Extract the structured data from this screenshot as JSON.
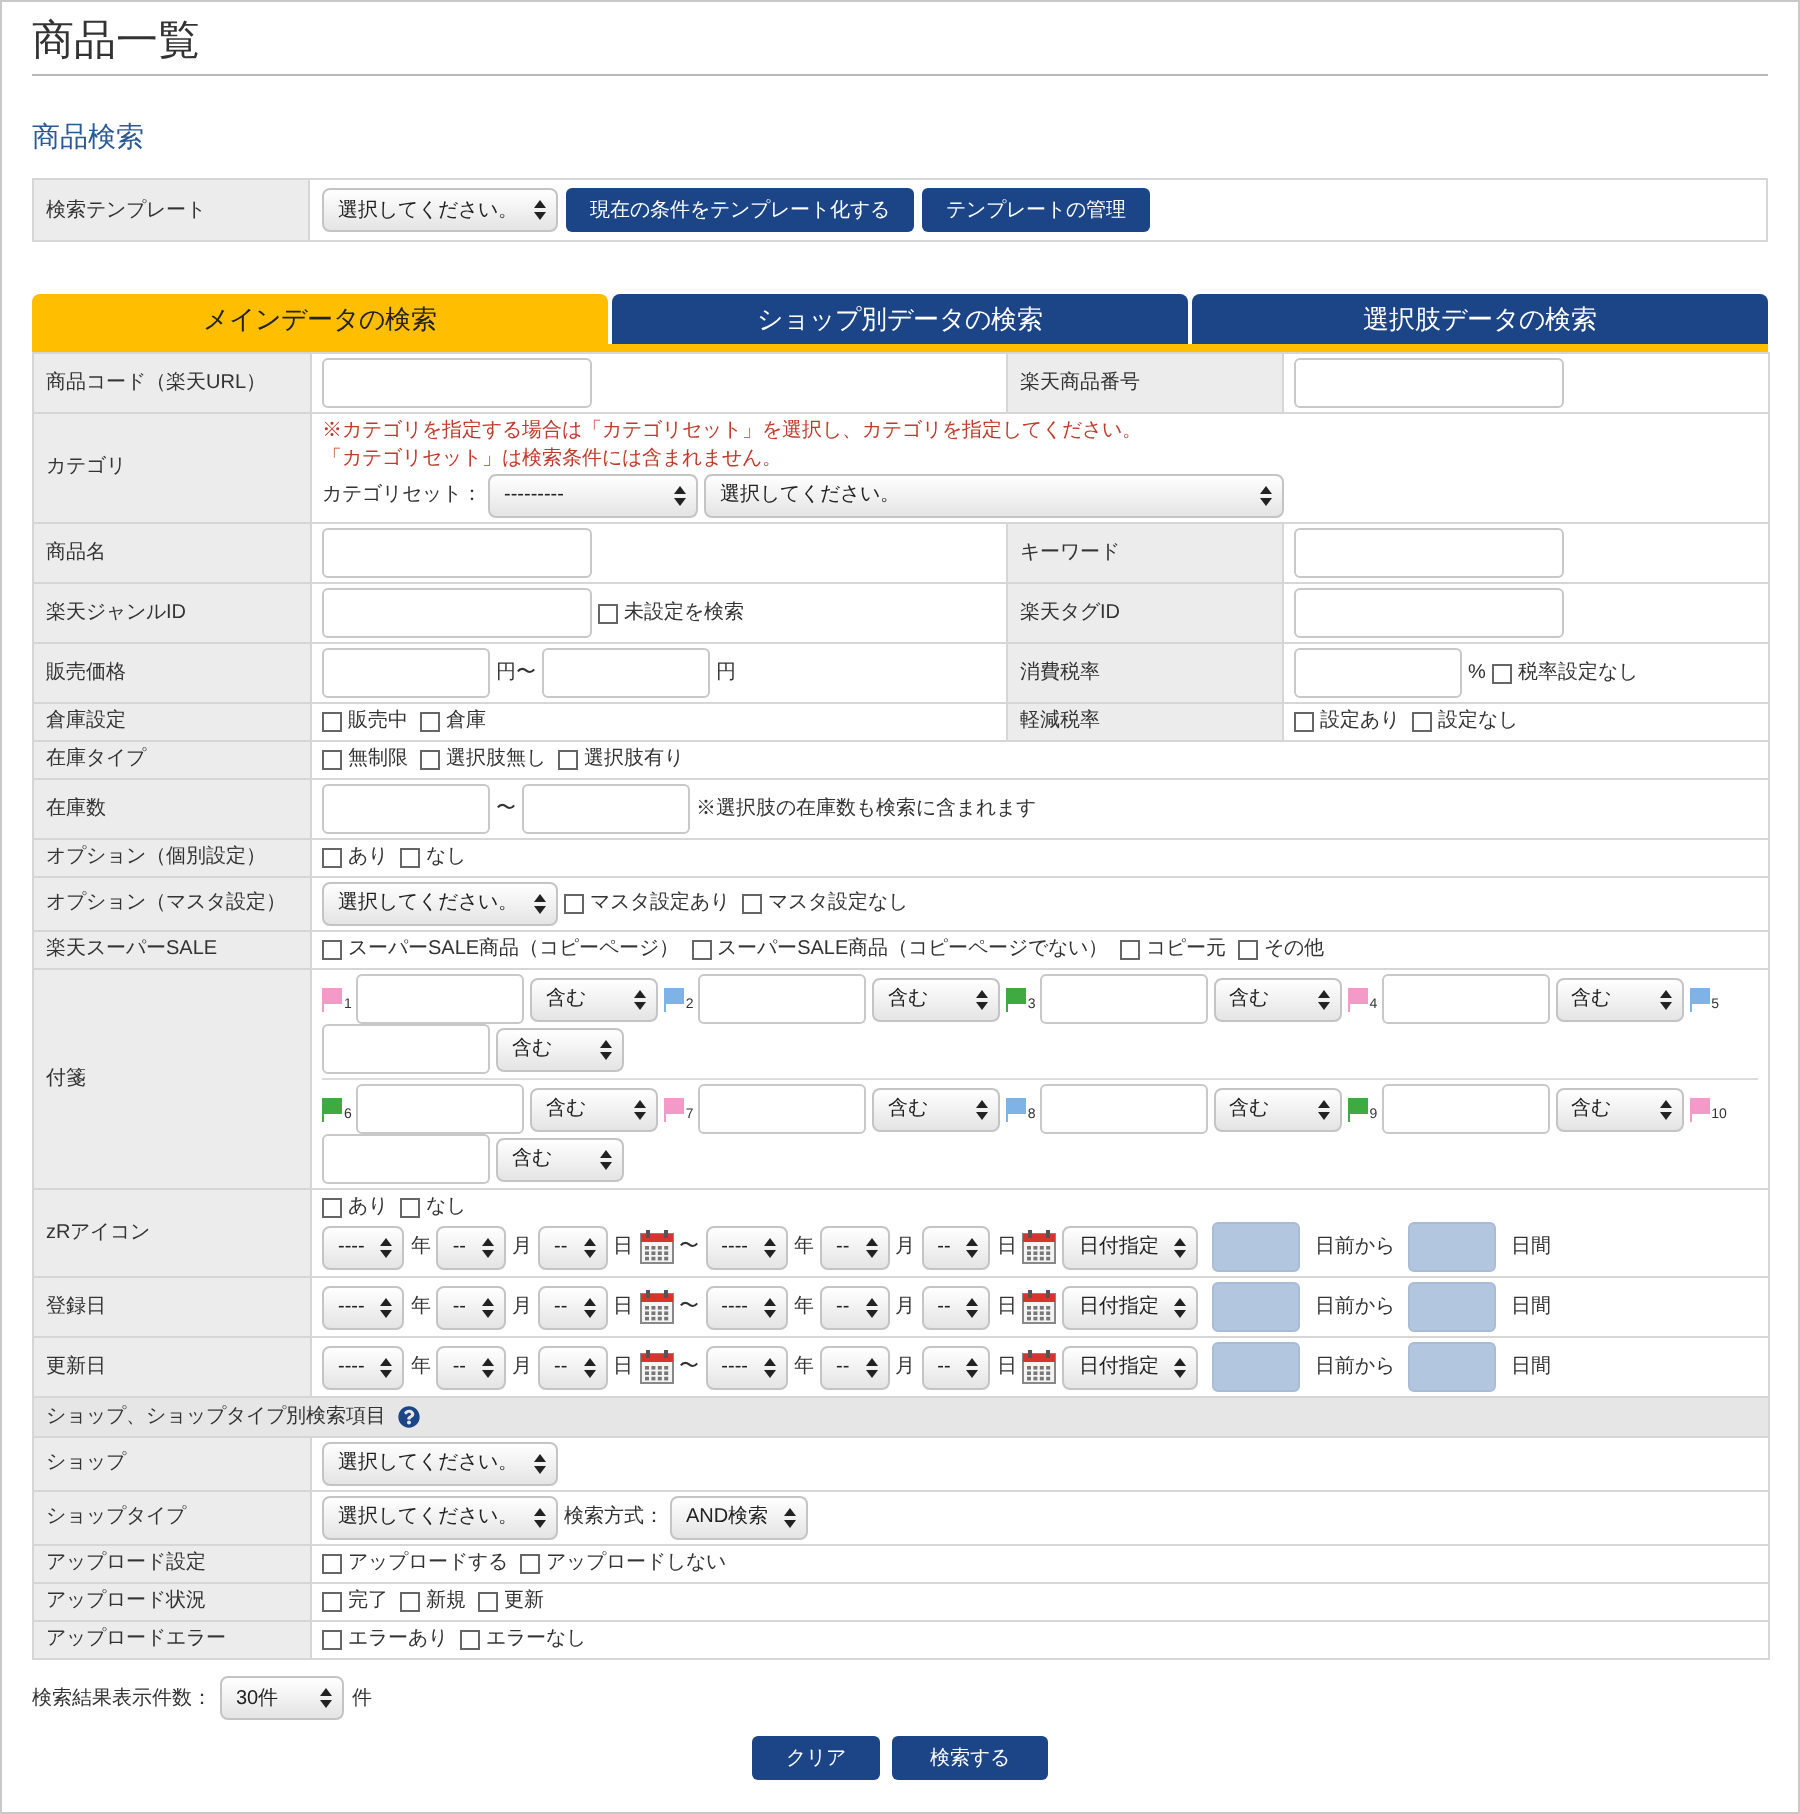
{
  "title": "商品一覧",
  "search_heading": "商品検索",
  "template": {
    "label": "検索テンプレート",
    "select": "選択してください。",
    "buttons": [
      "現在の条件をテンプレート化する",
      "テンプレートの管理"
    ]
  },
  "tabs": [
    {
      "label": "メインデータの検索",
      "selected": true
    },
    {
      "label": "ショップ別データの検索",
      "selected": false
    },
    {
      "label": "選択肢データの検索",
      "selected": false
    }
  ],
  "rows": [
    {
      "kind": "pair",
      "label": "商品コード（楽天URL）",
      "lines": [
        [
          {
            "kind": "input"
          }
        ]
      ],
      "label2": "楽天商品番号",
      "lines2": [
        [
          {
            "kind": "input"
          }
        ]
      ]
    },
    {
      "kind": "single",
      "label": "カテゴリ",
      "lines": [
        [
          {
            "kind": "note",
            "text": "※カテゴリを指定する場合は「カテゴリセット」を選択し、カテゴリを指定してください。"
          }
        ],
        [
          {
            "kind": "note",
            "text": "「カテゴリセット」は検索条件には含まれません。"
          }
        ],
        [
          {
            "kind": "text",
            "text": "カテゴリセット："
          },
          {
            "kind": "large-select",
            "value": "---------"
          },
          {
            "kind": "wide-select",
            "value": "選択してください。"
          }
        ]
      ]
    },
    {
      "kind": "pair",
      "label": "商品名",
      "lines": [
        [
          {
            "kind": "input"
          }
        ]
      ],
      "label2": "キーワード",
      "lines2": [
        [
          {
            "kind": "input"
          }
        ]
      ]
    },
    {
      "kind": "pair",
      "label": "楽天ジャンルID",
      "lines": [
        [
          {
            "kind": "input"
          },
          {
            "kind": "checkbox",
            "label": "未設定を検索",
            "checked": false
          }
        ]
      ],
      "label2": "楽天タグID",
      "lines2": [
        [
          {
            "kind": "input"
          }
        ]
      ]
    },
    {
      "kind": "pair",
      "label": "販売価格",
      "lines": [
        [
          {
            "kind": "short-input"
          },
          {
            "kind": "text",
            "text": "円〜"
          },
          {
            "kind": "short-input"
          },
          {
            "kind": "text",
            "text": "円"
          }
        ]
      ],
      "label2": "消費税率",
      "lines2": [
        [
          {
            "kind": "short-input"
          },
          {
            "kind": "text",
            "text": "%"
          },
          {
            "kind": "checkbox",
            "label": "税率設定なし",
            "checked": false
          }
        ]
      ]
    },
    {
      "kind": "pair",
      "label": "倉庫設定",
      "lines": [
        [
          {
            "kind": "checkbox",
            "label": "販売中",
            "checked": false
          },
          {
            "kind": "checkbox",
            "label": "倉庫",
            "checked": false
          }
        ]
      ],
      "label2": "軽減税率",
      "lines2": [
        [
          {
            "kind": "checkbox",
            "label": "設定あり",
            "checked": false
          },
          {
            "kind": "checkbox",
            "label": "設定なし",
            "checked": false
          }
        ]
      ]
    },
    {
      "kind": "single",
      "label": "在庫タイプ",
      "lines": [
        [
          {
            "kind": "checkbox",
            "label": "無制限",
            "checked": false
          },
          {
            "kind": "checkbox",
            "label": "選択肢無し",
            "checked": false
          },
          {
            "kind": "checkbox",
            "label": "選択肢有り",
            "checked": false
          }
        ]
      ]
    },
    {
      "kind": "single",
      "label": "在庫数",
      "lines": [
        [
          {
            "kind": "short-input"
          },
          {
            "kind": "text",
            "text": "〜"
          },
          {
            "kind": "short-input"
          },
          {
            "kind": "text",
            "text": "※選択肢の在庫数も検索に含まれます"
          }
        ]
      ]
    },
    {
      "kind": "single",
      "label": "オプション（個別設定）",
      "lines": [
        [
          {
            "kind": "checkbox",
            "label": "あり",
            "checked": false
          },
          {
            "kind": "checkbox",
            "label": "なし",
            "checked": false
          }
        ]
      ]
    },
    {
      "kind": "single",
      "label": "オプション（マスタ設定）",
      "lines": [
        [
          {
            "kind": "select",
            "value": "選択してください。"
          },
          {
            "kind": "checkbox",
            "label": "マスタ設定あり",
            "checked": false
          },
          {
            "kind": "checkbox",
            "label": "マスタ設定なし",
            "checked": false
          }
        ]
      ]
    },
    {
      "kind": "single",
      "label": "楽天スーパーSALE",
      "lines": [
        [
          {
            "kind": "checkbox",
            "label": "スーパーSALE商品（コピーページ）",
            "checked": false
          },
          {
            "kind": "checkbox",
            "label": "スーパーSALE商品（コピーページでない）",
            "checked": false
          },
          {
            "kind": "checkbox",
            "label": "コピー元",
            "checked": false
          },
          {
            "kind": "checkbox",
            "label": "その他",
            "checked": false
          }
        ]
      ]
    },
    {
      "kind": "single",
      "label": "付箋",
      "divided": true,
      "lines": [
        [
          {
            "kind": "flag",
            "color": "#f49ac8",
            "number": "1"
          },
          {
            "kind": "short-input"
          },
          {
            "kind": "medium-select",
            "value": "含む"
          },
          {
            "kind": "flag",
            "color": "#7fb3e8",
            "number": "2"
          },
          {
            "kind": "short-input"
          },
          {
            "kind": "medium-select",
            "value": "含む"
          },
          {
            "kind": "flag",
            "color": "#3faa3f",
            "number": "3"
          },
          {
            "kind": "short-input"
          },
          {
            "kind": "medium-select",
            "value": "含む"
          },
          {
            "kind": "flag",
            "color": "#f49ac8",
            "number": "4"
          },
          {
            "kind": "short-input"
          },
          {
            "kind": "medium-select",
            "value": "含む"
          },
          {
            "kind": "flag",
            "color": "#7fb3e8",
            "number": "5"
          },
          {
            "kind": "break"
          },
          {
            "kind": "short-input"
          },
          {
            "kind": "medium-select",
            "value": "含む"
          }
        ],
        [
          {
            "kind": "flag",
            "color": "#3faa3f",
            "number": "6"
          },
          {
            "kind": "short-input"
          },
          {
            "kind": "medium-select",
            "value": "含む"
          },
          {
            "kind": "flag",
            "color": "#f49ac8",
            "number": "7"
          },
          {
            "kind": "short-input"
          },
          {
            "kind": "medium-select",
            "value": "含む"
          },
          {
            "kind": "flag",
            "color": "#7fb3e8",
            "number": "8"
          },
          {
            "kind": "short-input"
          },
          {
            "kind": "medium-select",
            "value": "含む"
          },
          {
            "kind": "flag",
            "color": "#3faa3f",
            "number": "9"
          },
          {
            "kind": "short-input"
          },
          {
            "kind": "medium-select",
            "value": "含む"
          },
          {
            "kind": "flag",
            "color": "#f49ac8",
            "number": "10"
          },
          {
            "kind": "break"
          },
          {
            "kind": "short-input"
          },
          {
            "kind": "medium-select",
            "value": "含む"
          }
        ]
      ]
    },
    {
      "kind": "single",
      "label": "zRアイコン",
      "lines": [
        [
          {
            "kind": "checkbox",
            "label": "あり",
            "checked": false
          },
          {
            "kind": "checkbox",
            "label": "なし",
            "checked": false
          }
        ],
        [
          {
            "kind": "select",
            "value": "----"
          },
          {
            "kind": "text",
            "text": "年"
          },
          {
            "kind": "select",
            "value": "--"
          },
          {
            "kind": "text",
            "text": "月"
          },
          {
            "kind": "select",
            "value": "--"
          },
          {
            "kind": "text",
            "text": "日"
          },
          {
            "kind": "calendar"
          },
          {
            "kind": "text",
            "text": "〜"
          },
          {
            "kind": "select",
            "value": "----"
          },
          {
            "kind": "text",
            "text": "年"
          },
          {
            "kind": "select",
            "value": "--"
          },
          {
            "kind": "text",
            "text": "月"
          },
          {
            "kind": "select",
            "value": "--"
          },
          {
            "kind": "text",
            "text": "日"
          },
          {
            "kind": "calendar"
          },
          {
            "kind": "select",
            "value": "日付指定"
          },
          {
            "kind": "blue-box"
          },
          {
            "kind": "text",
            "text": "日前から"
          },
          {
            "kind": "blue-box"
          },
          {
            "kind": "text",
            "text": "日間"
          }
        ]
      ]
    },
    {
      "kind": "single",
      "label": "登録日",
      "lines": [
        [
          {
            "kind": "select",
            "value": "----"
          },
          {
            "kind": "text",
            "text": "年"
          },
          {
            "kind": "select",
            "value": "--"
          },
          {
            "kind": "text",
            "text": "月"
          },
          {
            "kind": "select",
            "value": "--"
          },
          {
            "kind": "text",
            "text": "日"
          },
          {
            "kind": "calendar"
          },
          {
            "kind": "text",
            "text": "〜"
          },
          {
            "kind": "select",
            "value": "----"
          },
          {
            "kind": "text",
            "text": "年"
          },
          {
            "kind": "select",
            "value": "--"
          },
          {
            "kind": "text",
            "text": "月"
          },
          {
            "kind": "select",
            "value": "--"
          },
          {
            "kind": "text",
            "text": "日"
          },
          {
            "kind": "calendar"
          },
          {
            "kind": "select",
            "value": "日付指定"
          },
          {
            "kind": "blue-box"
          },
          {
            "kind": "text",
            "text": "日前から"
          },
          {
            "kind": "blue-box"
          },
          {
            "kind": "text",
            "text": "日間"
          }
        ]
      ]
    },
    {
      "kind": "single",
      "label": "更新日",
      "lines": [
        [
          {
            "kind": "select",
            "value": "----"
          },
          {
            "kind": "text",
            "text": "年"
          },
          {
            "kind": "select",
            "value": "--"
          },
          {
            "kind": "text",
            "text": "月"
          },
          {
            "kind": "select",
            "value": "--"
          },
          {
            "kind": "text",
            "text": "日"
          },
          {
            "kind": "calendar"
          },
          {
            "kind": "text",
            "text": "〜"
          },
          {
            "kind": "select",
            "value": "----"
          },
          {
            "kind": "text",
            "text": "年"
          },
          {
            "kind": "select",
            "value": "--"
          },
          {
            "kind": "text",
            "text": "月"
          },
          {
            "kind": "select",
            "value": "--"
          },
          {
            "kind": "text",
            "text": "日"
          },
          {
            "kind": "calendar"
          },
          {
            "kind": "select",
            "value": "日付指定"
          },
          {
            "kind": "blue-box"
          },
          {
            "kind": "text",
            "text": "日前から"
          },
          {
            "kind": "blue-box"
          },
          {
            "kind": "text",
            "text": "日間"
          }
        ]
      ]
    },
    {
      "kind": "section",
      "label": "ショップ、ショップタイプ別検索項目",
      "help": true
    },
    {
      "kind": "single",
      "label": "ショップ",
      "lines": [
        [
          {
            "kind": "select",
            "value": "選択してください。"
          }
        ]
      ]
    },
    {
      "kind": "single",
      "label": "ショップタイプ",
      "lines": [
        [
          {
            "kind": "select",
            "value": "選択してください。"
          },
          {
            "kind": "text",
            "text": "検索方式："
          },
          {
            "kind": "select",
            "value": "AND検索"
          }
        ]
      ]
    },
    {
      "kind": "single",
      "label": "アップロード設定",
      "lines": [
        [
          {
            "kind": "checkbox",
            "label": "アップロードする",
            "checked": false
          },
          {
            "kind": "checkbox",
            "label": "アップロードしない",
            "checked": false
          }
        ]
      ]
    },
    {
      "kind": "single",
      "label": "アップロード状況",
      "lines": [
        [
          {
            "kind": "checkbox",
            "label": "完了",
            "checked": false
          },
          {
            "kind": "checkbox",
            "label": "新規",
            "checked": false
          },
          {
            "kind": "checkbox",
            "label": "更新",
            "checked": false
          }
        ]
      ]
    },
    {
      "kind": "single",
      "label": "アップロードエラー",
      "lines": [
        [
          {
            "kind": "checkbox",
            "label": "エラーあり",
            "checked": false
          },
          {
            "kind": "checkbox",
            "label": "エラーなし",
            "checked": false
          }
        ]
      ]
    }
  ],
  "result_count": {
    "label": "検索結果表示件数：",
    "select": "30件",
    "unit": "件"
  },
  "buttons": [
    "クリア",
    "検索する"
  ]
}
